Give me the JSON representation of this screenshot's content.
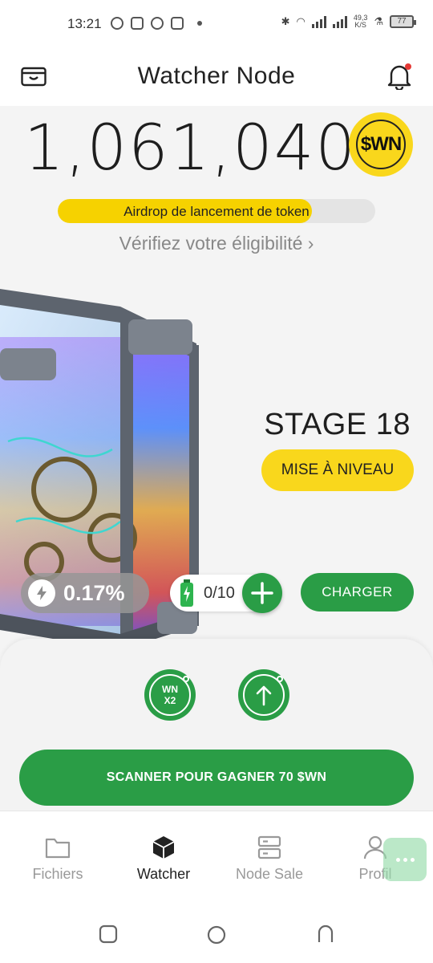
{
  "status_bar": {
    "time": "13:21",
    "net_speed_top": "49,3",
    "net_speed_bottom": "K/S",
    "battery": "77"
  },
  "header": {
    "title": "Watcher Node"
  },
  "balance": {
    "amount": "1,061,040",
    "token": "$WN"
  },
  "airdrop": {
    "label": "Airdrop de lancement de token",
    "progress": 0.8
  },
  "eligibility": {
    "text": "Vérifiez votre éligibilité ›"
  },
  "stage": {
    "label": "STAGE 18",
    "upgrade_label": "MISE À NIVEAU"
  },
  "mining": {
    "rate": "0.17%",
    "charges": "0/10",
    "charger_label": "CHARGER"
  },
  "panel": {
    "wn_badge_line1": "WN",
    "wn_badge_line2": "X2",
    "scan_label": "SCANNER POUR GAGNER 70 $WN"
  },
  "nav": {
    "items": [
      {
        "label": "Fichiers",
        "icon": "folder-icon"
      },
      {
        "label": "Watcher",
        "icon": "cube-icon"
      },
      {
        "label": "Node Sale",
        "icon": "server-icon"
      },
      {
        "label": "Profil",
        "icon": "user-icon"
      }
    ],
    "active": "Watcher"
  },
  "colors": {
    "green": "#2a9d46",
    "yellow": "#f9d71c",
    "accent_red": "#e53935"
  }
}
